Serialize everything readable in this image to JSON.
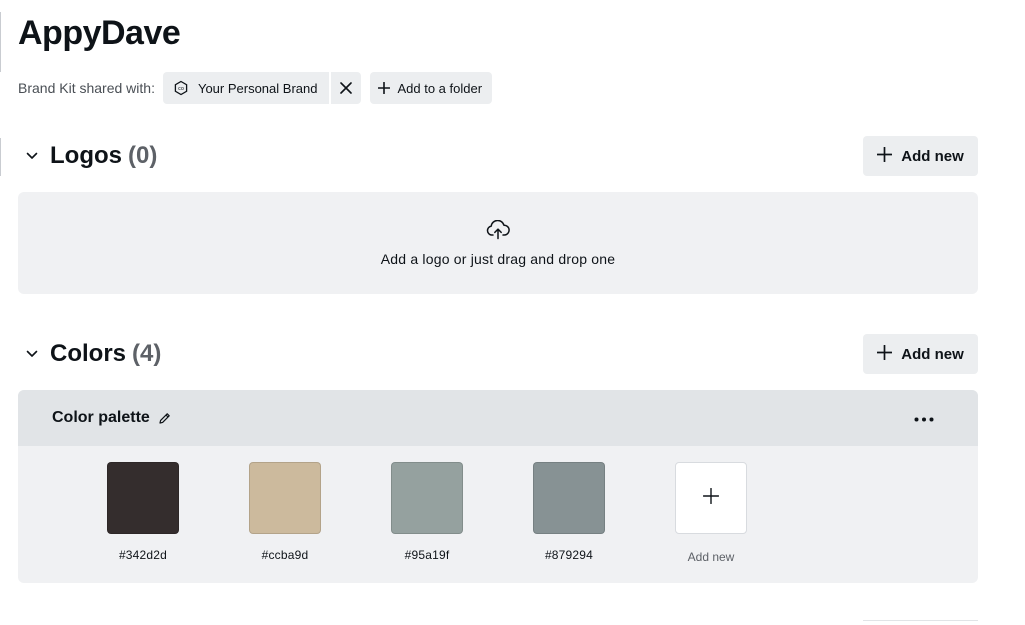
{
  "page": {
    "title": "AppyDave"
  },
  "shared": {
    "label": "Brand Kit shared with:",
    "brand_chip": "Your Personal Brand",
    "folder_chip": "Add to a folder"
  },
  "logos": {
    "title": "Logos",
    "count": "(0)",
    "add_new": "Add new",
    "drop_text": "Add a logo or just drag and drop one"
  },
  "colors": {
    "title": "Colors",
    "count": "(4)",
    "add_new": "Add new",
    "palette": {
      "name": "Color palette",
      "swatches": [
        {
          "hex": "#342d2d"
        },
        {
          "hex": "#ccba9d"
        },
        {
          "hex": "#95a19f"
        },
        {
          "hex": "#879294"
        }
      ],
      "add_label": "Add new"
    }
  },
  "icons": {
    "brand_chip": "brand-badge-icon",
    "remove": "close-icon",
    "add": "plus-icon",
    "collapse": "chevron-down-icon",
    "upload": "cloud-upload-icon",
    "edit": "pencil-icon",
    "more": "more-horizontal-icon"
  }
}
